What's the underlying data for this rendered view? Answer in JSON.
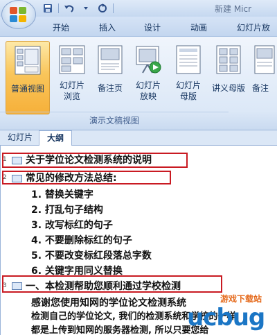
{
  "window": {
    "title": "新建 Micr"
  },
  "quick_access": {
    "save_icon": "save-icon",
    "undo_icon": "undo-icon",
    "redo_icon": "redo-icon"
  },
  "ribbon_tabs": [
    "开始",
    "插入",
    "设计",
    "动画",
    "幻灯片放"
  ],
  "view_buttons": [
    {
      "label": "普通视图",
      "active": true
    },
    {
      "label": "幻灯片\n浏览",
      "active": false
    },
    {
      "label": "备注页",
      "active": false
    },
    {
      "label": "幻灯片\n放映",
      "active": false
    },
    {
      "label": "幻灯片\n母版",
      "active": false
    },
    {
      "label": "讲义母版",
      "active": false
    },
    {
      "label": "备注",
      "active": false
    }
  ],
  "group_label": "演示文稿视图",
  "panel_tabs": {
    "slides": "幻灯片",
    "outline": "大纲"
  },
  "outline": {
    "slide1": {
      "number": "1",
      "title": "关于学位论文检测系统的说明"
    },
    "slide2": {
      "number": "2",
      "title": "常见的修改方法总结:"
    },
    "items": [
      "1. 替换关键字",
      "2. 打乱句子结构",
      "3. 改写标红的句子",
      "4. 不要删除标红的句子",
      "5. 不要改变标红段落总字数",
      "6. 关键字用同义替换"
    ],
    "slide3": {
      "number": "3",
      "title": "一、本检测帮助您顺利通过学校检测"
    },
    "body": [
      "感谢您使用知网的学位论文检测系统",
      "检测自己的学位论文, 我们的检测系统和学校的一样,",
      "都是上传到知网的服务器检测, 所以只要您给"
    ]
  },
  "watermark": {
    "logo": "ucbug",
    "text": "游戏下载站"
  },
  "colors": {
    "highlight_box": "#c91a22",
    "active_button": "#f9c55a",
    "ribbon_bg": "#dce8f7"
  }
}
